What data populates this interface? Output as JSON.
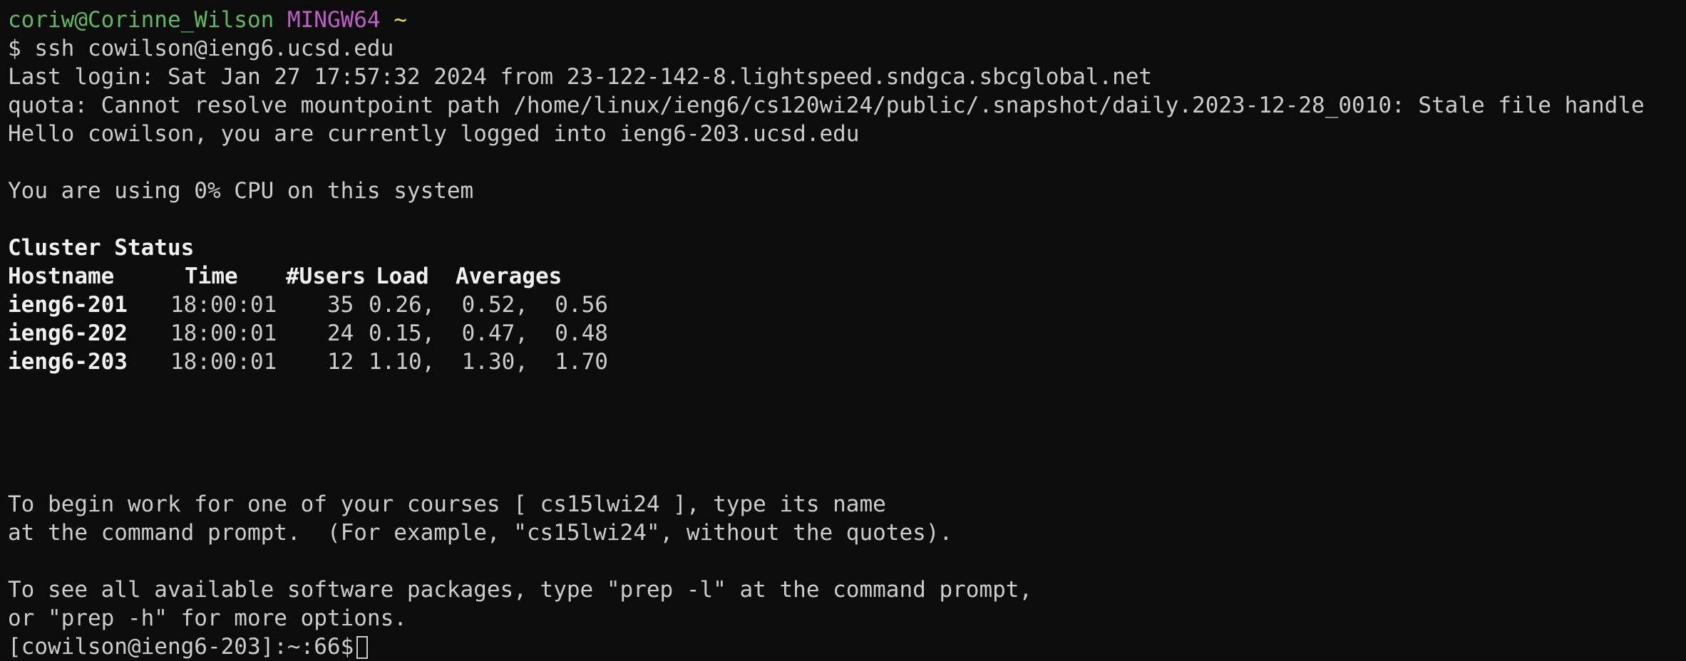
{
  "prompt_header": {
    "user_host": "coriw@Corinne_Wilson",
    "shell": "MINGW64",
    "path": "~",
    "colors": {
      "user_host": "#5fba5f",
      "shell": "#c05ec8",
      "path": "#e5e52b"
    }
  },
  "lines": {
    "ssh_command": "$ ssh cowilson@ieng6.ucsd.edu",
    "last_login": "Last login: Sat Jan 27 17:57:32 2024 from 23-122-142-8.lightspeed.sndgca.sbcglobal.net",
    "quota_error": "quota: Cannot resolve mountpoint path /home/linux/ieng6/cs120wi24/public/.snapshot/daily.2023-12-28_0010: Stale file handle",
    "hello": "Hello cowilson, you are currently logged into ieng6-203.ucsd.edu",
    "cpu_usage": "You are using 0% CPU on this system",
    "cluster_title": "Cluster Status",
    "begin_work_1": "To begin work for one of your courses [ cs15lwi24 ], type its name",
    "begin_work_2": "at the command prompt.  (For example, \"cs15lwi24\", without the quotes).",
    "packages_1": "To see all available software packages, type \"prep -l\" at the command prompt,",
    "packages_2": "or \"prep -h\" for more options.",
    "final_prompt": "[cowilson@ieng6-203]:~:66$"
  },
  "cluster_table": {
    "headers": [
      "Hostname",
      "Time",
      "#Users",
      "Load  Averages"
    ],
    "rows": [
      {
        "host": "ieng6-201",
        "time": "18:00:01",
        "users": "35",
        "load": "0.26,  0.52,  0.56"
      },
      {
        "host": "ieng6-202",
        "time": "18:00:01",
        "users": "24",
        "load": "0.15,  0.47,  0.48"
      },
      {
        "host": "ieng6-203",
        "time": "18:00:01",
        "users": "12",
        "load": "1.10,  1.30,  1.70"
      }
    ]
  }
}
